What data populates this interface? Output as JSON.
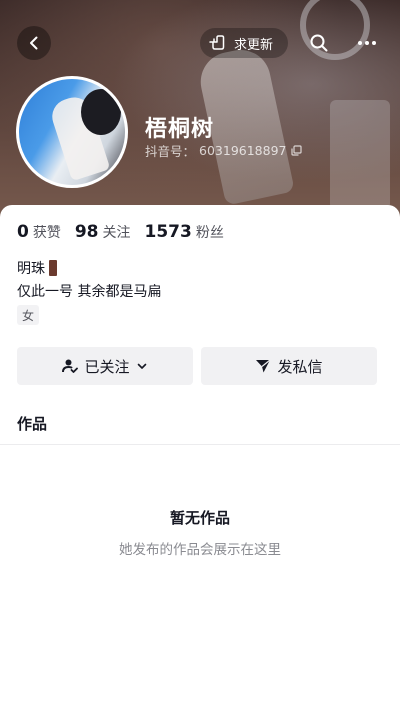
{
  "header": {
    "refresh_label": "求更新"
  },
  "profile": {
    "nickname": "梧桐树",
    "account_prefix": "抖音号：",
    "account_id": "60319618897"
  },
  "stats": [
    {
      "value": "0",
      "label": "获赞"
    },
    {
      "value": "98",
      "label": "关注"
    },
    {
      "value": "1573",
      "label": "粉丝"
    }
  ],
  "bio": {
    "line1": "明珠",
    "line2": "仅此一号 其余都是马扁",
    "gender": "女"
  },
  "actions": {
    "followed_label": "已关注",
    "message_label": "发私信"
  },
  "tabs": {
    "works_label": "作品"
  },
  "empty_state": {
    "title": "暂无作品",
    "subtitle": "她发布的作品会展示在这里"
  },
  "colors": {
    "text_primary": "#161823",
    "text_secondary": "#8a8b91",
    "button_bg": "#f1f1f3"
  }
}
